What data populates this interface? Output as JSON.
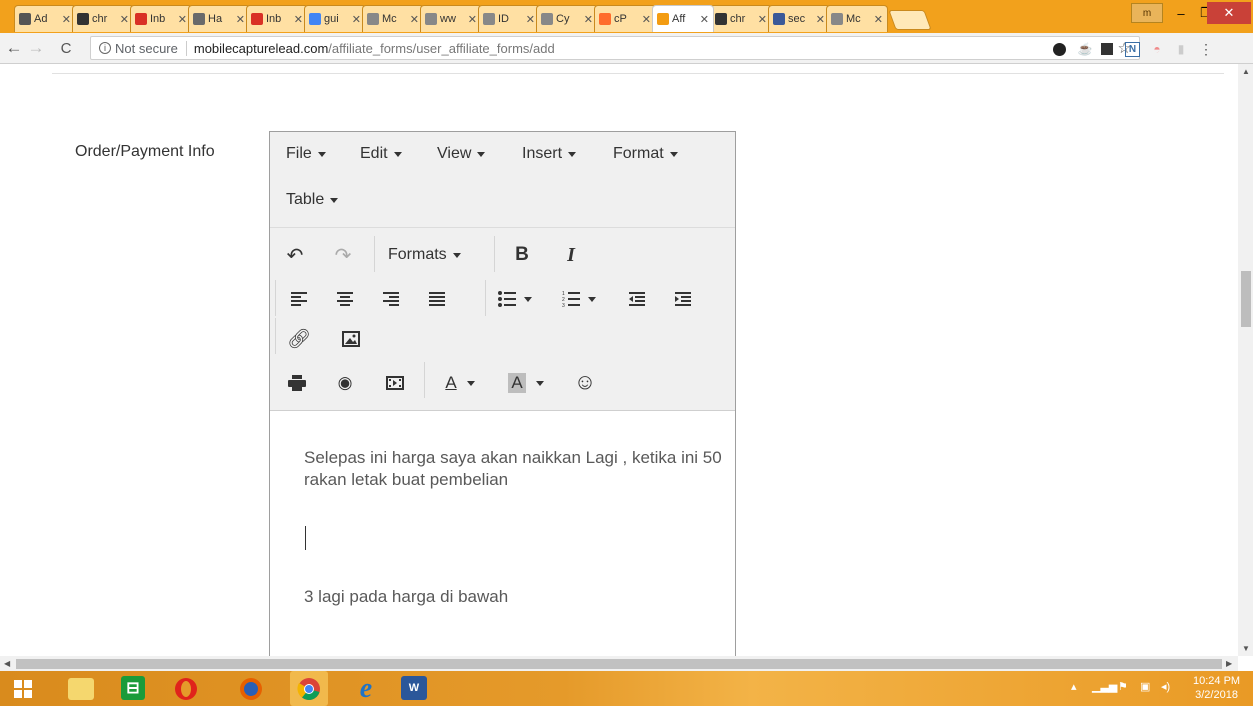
{
  "browser": {
    "tabs": [
      {
        "label": "Ad",
        "favicon": "calendar-icon",
        "color": "#555555"
      },
      {
        "label": "chr",
        "favicon": "chrome-icon",
        "color": "#333333"
      },
      {
        "label": "Inb",
        "favicon": "gmail-icon",
        "color": "#d93025"
      },
      {
        "label": "Ha",
        "favicon": "image-icon",
        "color": "#6a6a6a"
      },
      {
        "label": "Inb",
        "favicon": "gmail-icon",
        "color": "#d93025"
      },
      {
        "label": "gui",
        "favicon": "google-icon",
        "color": "#4285f4"
      },
      {
        "label": "Mc",
        "favicon": "page-icon",
        "color": "#888888"
      },
      {
        "label": "ww",
        "favicon": "page-icon",
        "color": "#888888"
      },
      {
        "label": "ID",
        "favicon": "page-icon",
        "color": "#888888"
      },
      {
        "label": "Cy",
        "favicon": "page-icon",
        "color": "#888888"
      },
      {
        "label": "cP",
        "favicon": "cpanel-icon",
        "color": "#ff6c2c"
      },
      {
        "label": "Aff",
        "favicon": "affiliate-icon",
        "color": "#f39c12",
        "active": true
      },
      {
        "label": "chr",
        "favicon": "chrome-icon",
        "color": "#333333"
      },
      {
        "label": "sec",
        "favicon": "facebook-icon",
        "color": "#3b5998"
      },
      {
        "label": "Mc",
        "favicon": "page-icon",
        "color": "#888888"
      }
    ],
    "close_glyph": "✕",
    "profile_label": "m",
    "window_controls": {
      "minimize": "–",
      "restore": "❐",
      "close": "✕"
    },
    "security_label": "Not secure",
    "url_host": "mobilecapturelead.com",
    "url_path": "/affiliate_forms/user_affiliate_forms/add"
  },
  "form": {
    "field_label": "Order/Payment Info"
  },
  "editor": {
    "menus": [
      "File",
      "Edit",
      "View",
      "Insert",
      "Format",
      "Table"
    ],
    "formats_label": "Formats",
    "bold_label": "B",
    "italic_label": "I",
    "text_color_label": "A",
    "bg_color_label": "A",
    "paragraph_1": "Selepas ini harga saya akan naikkan Lagi , ketika ini 50 rakan letak buat pembelian",
    "paragraph_2": "3 lagi pada harga di bawah"
  },
  "taskbar": {
    "time": "10:24 PM",
    "date": "3/2/2018"
  },
  "colors": {
    "tab_strip": "#f2a11c",
    "taskbar": "#e59a2a",
    "editor_chrome": "#f0f0f0",
    "body_text": "#595959"
  }
}
